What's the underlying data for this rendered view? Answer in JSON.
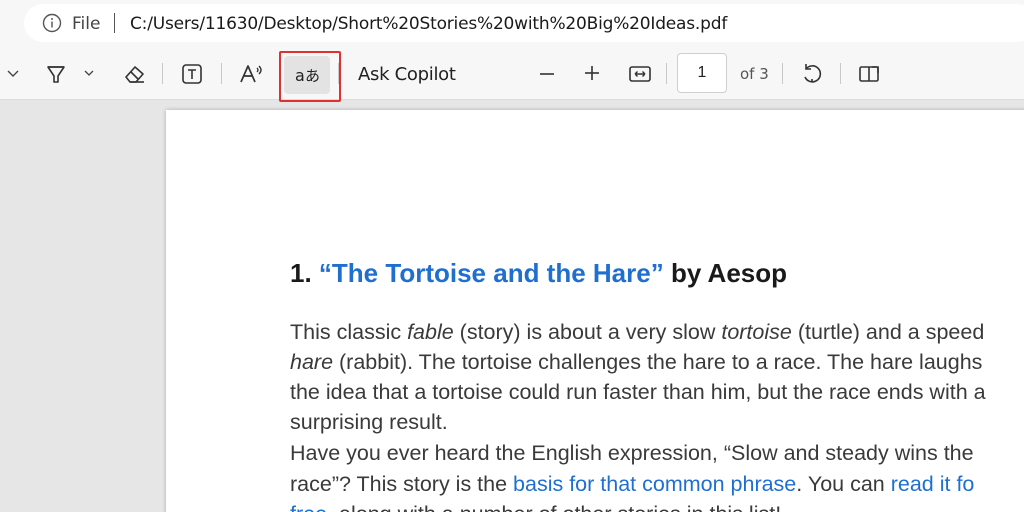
{
  "address_bar": {
    "file_label": "File",
    "url": "C:/Users/11630/Desktop/Short%20Stories%20with%20Big%20Ideas.pdf"
  },
  "toolbar": {
    "icons": [
      "chevron-down-icon",
      "highlighter-icon",
      "chevron-down-icon",
      "eraser-icon",
      "text-box-icon",
      "read-aloud-icon",
      "translate-icon",
      "zoom-out-icon",
      "zoom-in-icon",
      "fit-width-icon",
      "rotate-icon",
      "page-view-icon"
    ],
    "ask_copilot": "Ask Copilot",
    "page_number": "1",
    "page_of": "of 3",
    "highlight_color": "#e03131"
  },
  "document": {
    "heading": {
      "number": "1. ",
      "title": "“The Tortoise and the Hare”",
      "author": " by Aesop"
    },
    "lines": [
      {
        "a": "This classic ",
        "b": "fable",
        "c": " (story) is about a very slow ",
        "d": "tortoise",
        "e": " (turtle) and a speed"
      },
      {
        "a": "hare",
        "b": " (rabbit). The tortoise challenges the hare to a race. The hare laughs"
      },
      {
        "a": "the idea that a tortoise could run faster than him, but the race ends with a"
      },
      {
        "a": "surprising result."
      },
      {
        "a": "Have you ever heard the English expression, “Slow and steady wins the"
      },
      {
        "a": "race”? This story is the ",
        "b": "basis for that common phrase",
        "c": ". You can ",
        "d": "read it fo"
      },
      {
        "a": "free",
        "b": ", along with a number of other stories in this list!"
      }
    ],
    "link_color": "#1f6fd1"
  }
}
